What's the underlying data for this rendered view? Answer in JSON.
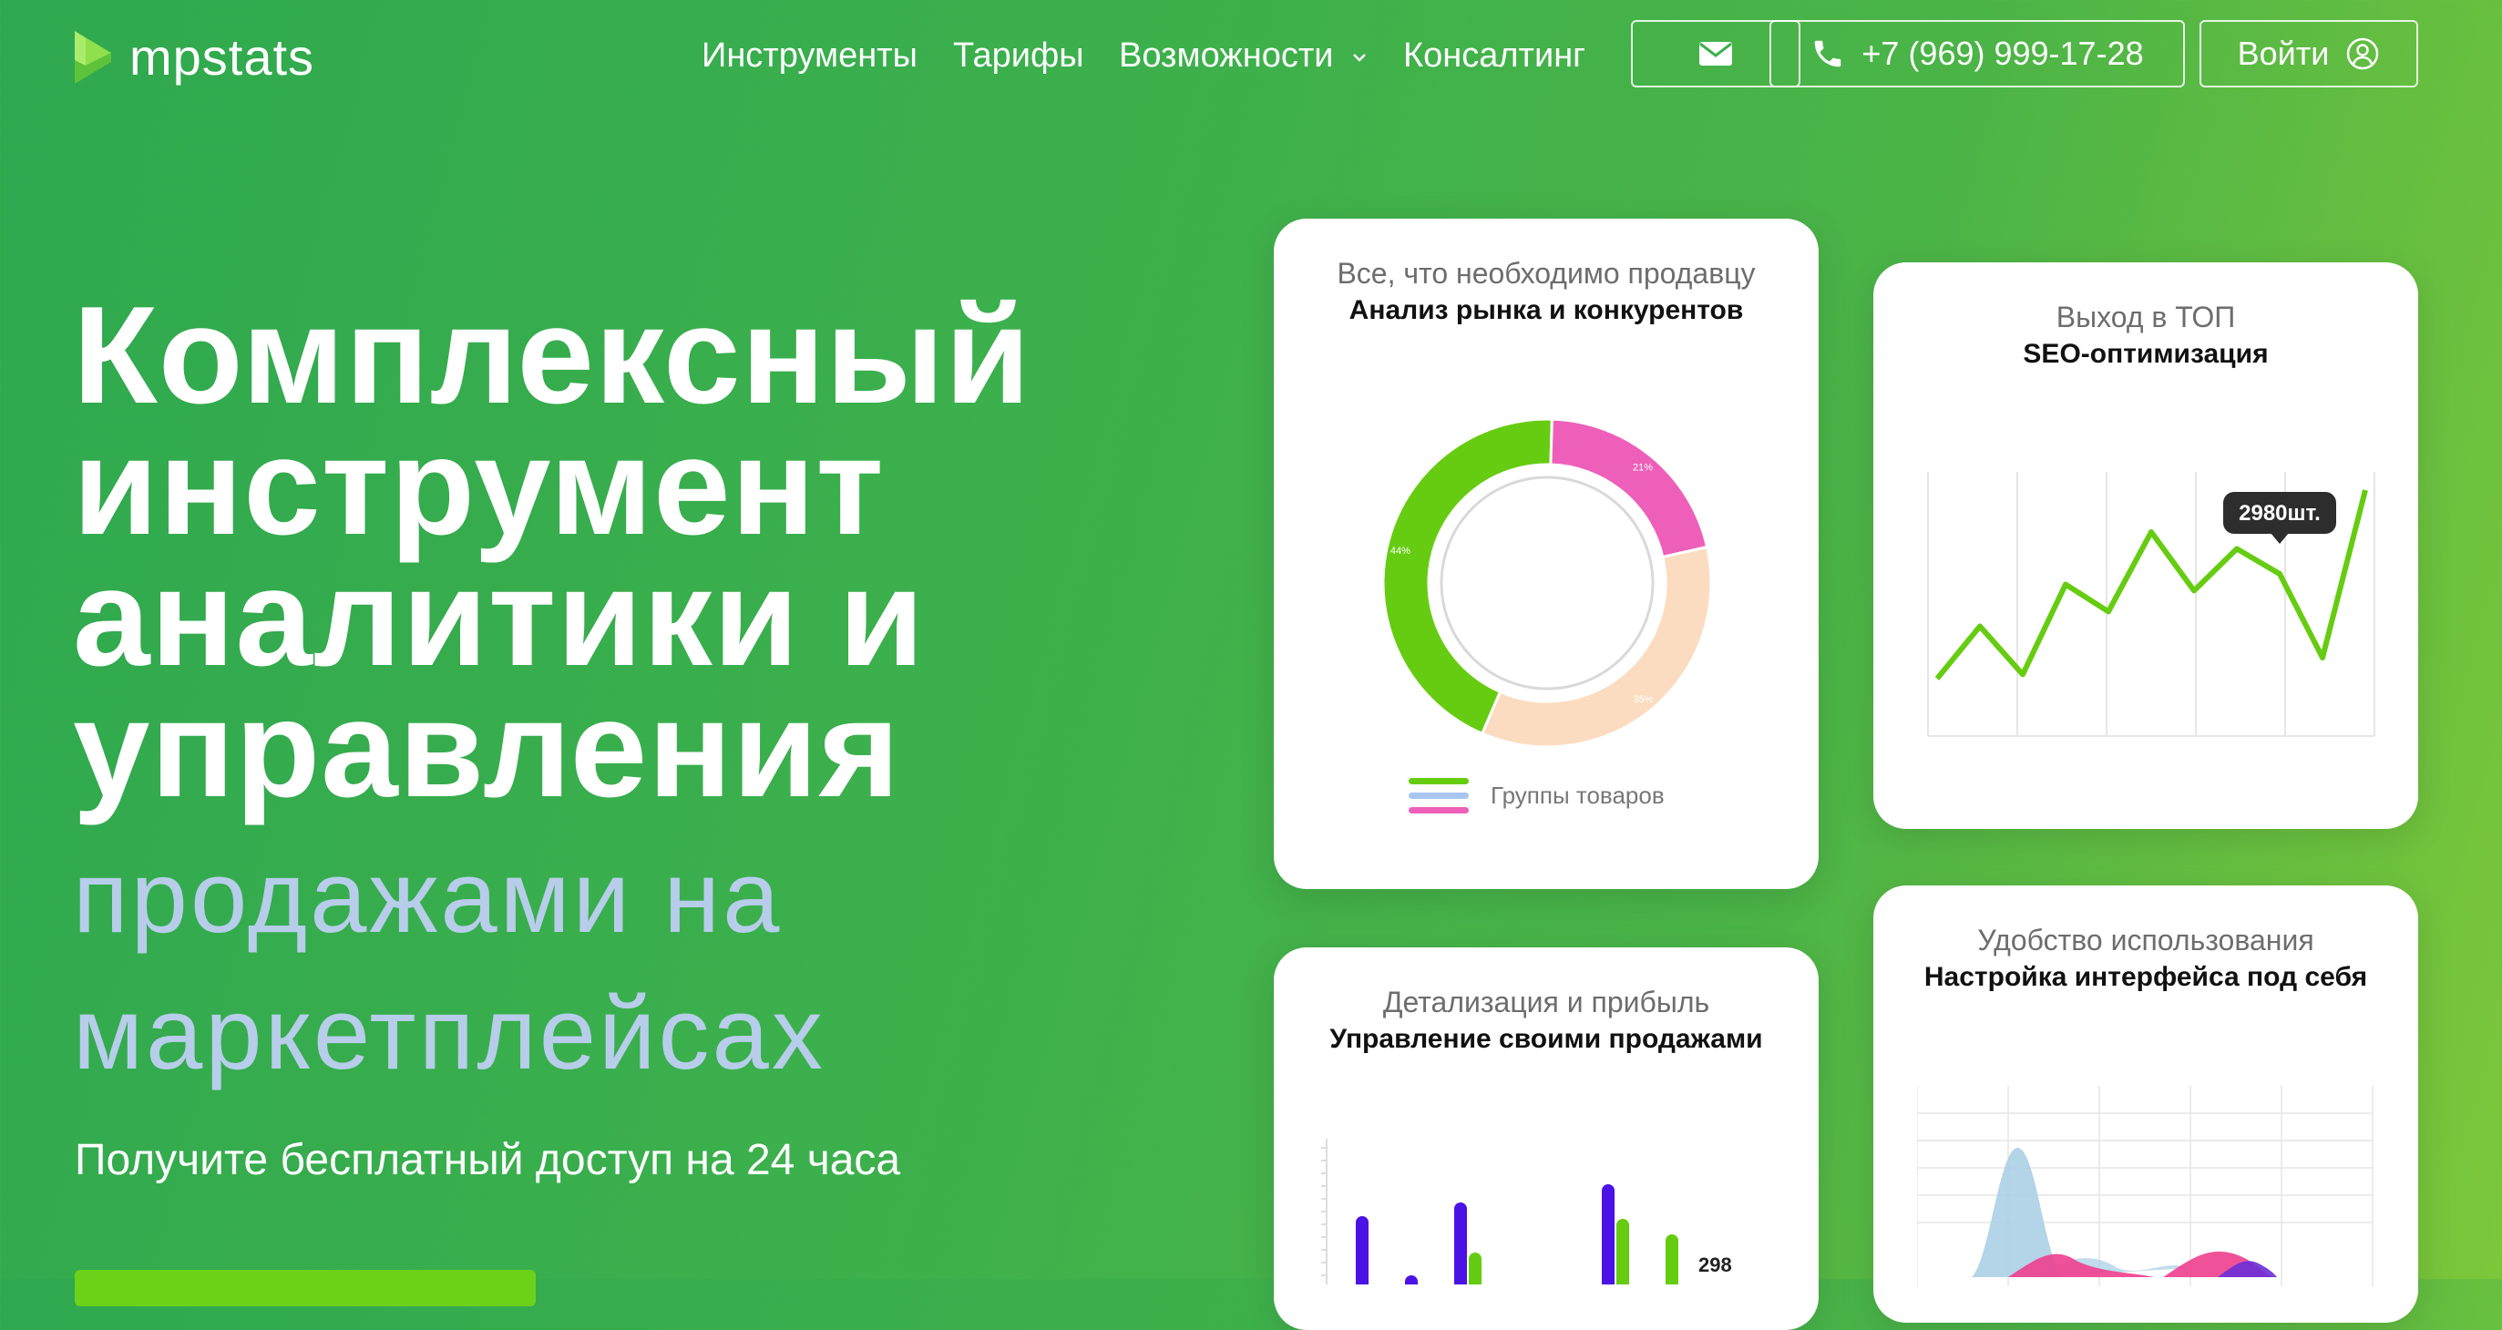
{
  "brand": {
    "name": "mpstats"
  },
  "nav": {
    "items": [
      "Инструменты",
      "Тарифы",
      "Возможности",
      "Консалтинг"
    ],
    "phone": "+7 (969) 999-17-28",
    "login": "Войти"
  },
  "hero": {
    "title_lines": [
      "Комплексный",
      "инструмент",
      "аналитики и",
      "управления"
    ],
    "sub_lines": [
      "продажами на",
      "маркетплейсах"
    ],
    "cta_text": "Получите бесплатный доступ на 24 часа"
  },
  "cards": {
    "market": {
      "subtitle": "Все, что необходимо продавцу",
      "title": "Анализ рынка и конкурентов",
      "legend": "Группы товаров",
      "chart_data": {
        "type": "pie",
        "slices": [
          {
            "label": "44%",
            "value": 44,
            "color": "#66cc11"
          },
          {
            "label": "21%",
            "value": 21,
            "color": "#ee5fb9"
          },
          {
            "label": "35%",
            "value": 35,
            "color": "#fcdcc0"
          }
        ]
      }
    },
    "seo": {
      "subtitle": "Выход в ТОП",
      "title": "SEO-оптимизация",
      "tooltip": "2980шт.",
      "chart_data": {
        "type": "line",
        "x": [
          0,
          1,
          2,
          3,
          4,
          5,
          6,
          7,
          8,
          9,
          10
        ],
        "values": [
          10,
          35,
          12,
          55,
          42,
          80,
          52,
          72,
          60,
          20,
          100
        ],
        "color": "#66cc11"
      }
    },
    "profit": {
      "subtitle": "Детализация и прибыль",
      "title": "Управление своими продажами",
      "value_label": "298",
      "chart_data": {
        "type": "bar",
        "series": [
          {
            "color": "#4b12e6",
            "values": [
              75,
              10,
              90,
              0,
              0,
              110,
              0
            ]
          },
          {
            "color": "#66cc11",
            "values": [
              0,
              0,
              35,
              0,
              0,
              72,
              55
            ]
          }
        ]
      }
    },
    "ux": {
      "subtitle": "Удобство использования",
      "title": "Настройка интерфейса под себя"
    }
  }
}
